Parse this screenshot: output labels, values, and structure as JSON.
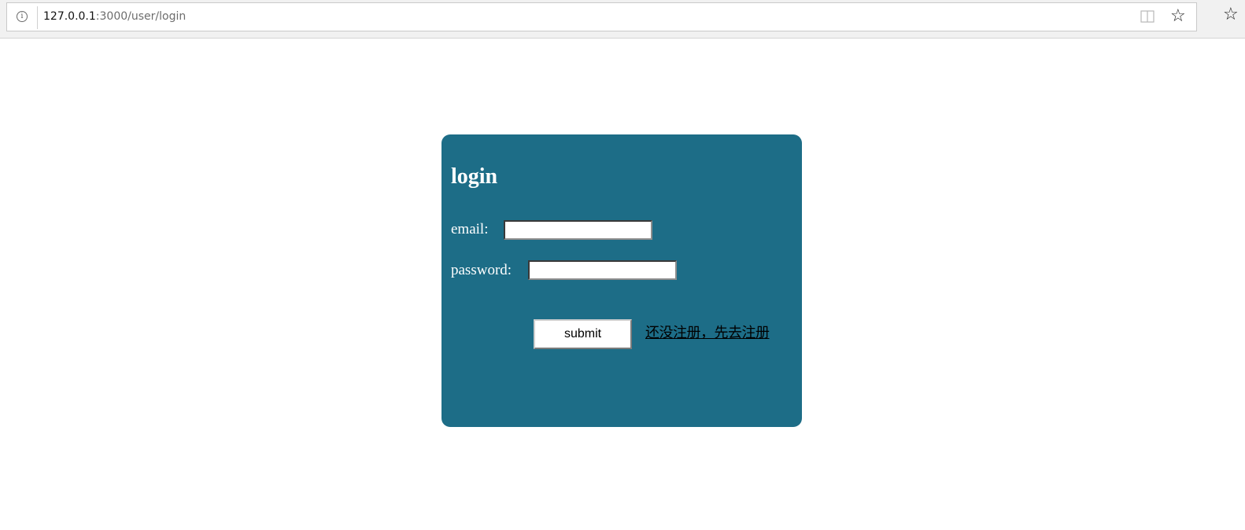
{
  "browser": {
    "url_host": "127.0.0.1",
    "url_path": ":3000/user/login",
    "icons": [
      "info-icon",
      "reading-view-icon",
      "favorite-star-icon",
      "favorites-icon"
    ]
  },
  "login": {
    "title": "login",
    "email_label": "email:",
    "email_value": "",
    "password_label": "password:",
    "password_value": "",
    "submit_label": "submit",
    "register_link": "还没注册，先去注册",
    "card_color": "#1d6d87"
  }
}
